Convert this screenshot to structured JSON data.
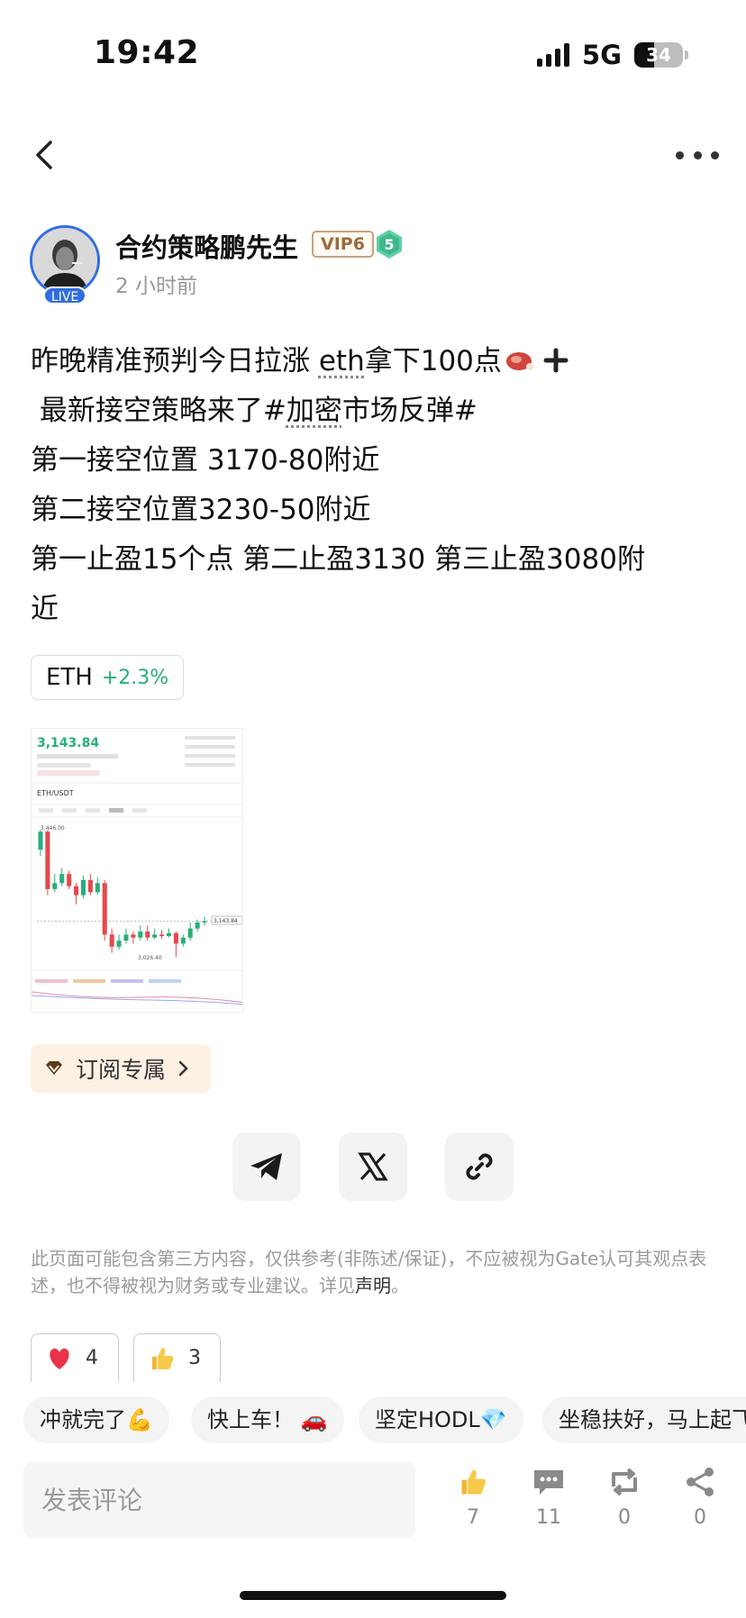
{
  "status_bar": {
    "time": "19:42",
    "network": "5G",
    "battery": "34"
  },
  "author": {
    "name": "合约策略鹏先生",
    "vip": "VIP6",
    "level": "5",
    "live": "LIVE",
    "time_ago": "2 小时前"
  },
  "post": {
    "lines": [
      {
        "pre": "昨晚精准预判今日拉涨 ",
        "underlined": "eth",
        "post": "拿下100点"
      },
      {
        "pre": " 最新接空策略来了#",
        "underlined": "加密",
        "post": "市场反弹#"
      },
      {
        "text": "第一接空位置 3170-80附近"
      },
      {
        "text": "第二接空位置3230-50附近"
      },
      {
        "text": "第一止盈15个点 第二止盈3130 第三止盈3080附"
      },
      {
        "text": "近"
      }
    ]
  },
  "ticker": {
    "symbol": "ETH",
    "change": "+2.3%"
  },
  "chart_thumb": {
    "price": "3,143.84",
    "pair": "ETH/USDT",
    "high_label": "3,446.00",
    "low_label": "3,026.40",
    "last_label": "3,143.84",
    "candles": [
      {
        "o": 3380,
        "c": 3440,
        "h": 3446,
        "l": 3360
      },
      {
        "o": 3440,
        "c": 3250,
        "h": 3445,
        "l": 3230
      },
      {
        "o": 3250,
        "c": 3270,
        "h": 3300,
        "l": 3240
      },
      {
        "o": 3270,
        "c": 3300,
        "h": 3320,
        "l": 3260
      },
      {
        "o": 3300,
        "c": 3260,
        "h": 3310,
        "l": 3250
      },
      {
        "o": 3260,
        "c": 3230,
        "h": 3270,
        "l": 3200
      },
      {
        "o": 3230,
        "c": 3280,
        "h": 3295,
        "l": 3220
      },
      {
        "o": 3280,
        "c": 3240,
        "h": 3300,
        "l": 3230
      },
      {
        "o": 3240,
        "c": 3270,
        "h": 3290,
        "l": 3230
      },
      {
        "o": 3270,
        "c": 3100,
        "h": 3280,
        "l": 3080
      },
      {
        "o": 3100,
        "c": 3060,
        "h": 3120,
        "l": 3040
      },
      {
        "o": 3060,
        "c": 3080,
        "h": 3100,
        "l": 3050
      },
      {
        "o": 3080,
        "c": 3100,
        "h": 3120,
        "l": 3070
      },
      {
        "o": 3100,
        "c": 3090,
        "h": 3110,
        "l": 3070
      },
      {
        "o": 3090,
        "c": 3110,
        "h": 3130,
        "l": 3080
      },
      {
        "o": 3110,
        "c": 3090,
        "h": 3130,
        "l": 3080
      },
      {
        "o": 3090,
        "c": 3100,
        "h": 3120,
        "l": 3085
      },
      {
        "o": 3100,
        "c": 3095,
        "h": 3115,
        "l": 3085
      },
      {
        "o": 3095,
        "c": 3105,
        "h": 3120,
        "l": 3090
      },
      {
        "o": 3105,
        "c": 3070,
        "h": 3110,
        "l": 3026
      },
      {
        "o": 3070,
        "c": 3090,
        "h": 3100,
        "l": 3060
      },
      {
        "o": 3090,
        "c": 3120,
        "h": 3140,
        "l": 3080
      },
      {
        "o": 3120,
        "c": 3140,
        "h": 3150,
        "l": 3110
      },
      {
        "o": 3140,
        "c": 3144,
        "h": 3160,
        "l": 3130
      }
    ],
    "range": [
      3000,
      3470
    ]
  },
  "subscribe": {
    "label": "订阅专属"
  },
  "share": [
    {
      "name": "telegram-share-button",
      "icon": "telegram-icon"
    },
    {
      "name": "x-share-button",
      "icon": "x-icon"
    },
    {
      "name": "copy-link-button",
      "icon": "link-icon"
    }
  ],
  "disclaimer": {
    "text": "此页面可能包含第三方内容，仅供参考(非陈述/保证)，不应被视为Gate认可其观点表述，也不得被视为财务或专业建议。详见",
    "link": "声明",
    "end": "。"
  },
  "reactions": [
    {
      "icon": "heart-icon",
      "count": "4"
    },
    {
      "icon": "thumbs-up-icon",
      "count": "3"
    }
  ],
  "quick_replies": [
    "冲就完了💪",
    "快上车！ 🚗",
    "坚定HODL💎",
    "坐稳扶好，马上起飞"
  ],
  "comment": {
    "placeholder": "发表评论"
  },
  "actions": [
    {
      "icon": "like-icon",
      "count": "7"
    },
    {
      "icon": "comment-icon",
      "count": "11"
    },
    {
      "icon": "repost-icon",
      "count": "0"
    },
    {
      "icon": "share-icon",
      "count": "0"
    }
  ],
  "colors": {
    "up": "#27b078",
    "down": "#e5484d",
    "accent": "#2f6de1"
  }
}
